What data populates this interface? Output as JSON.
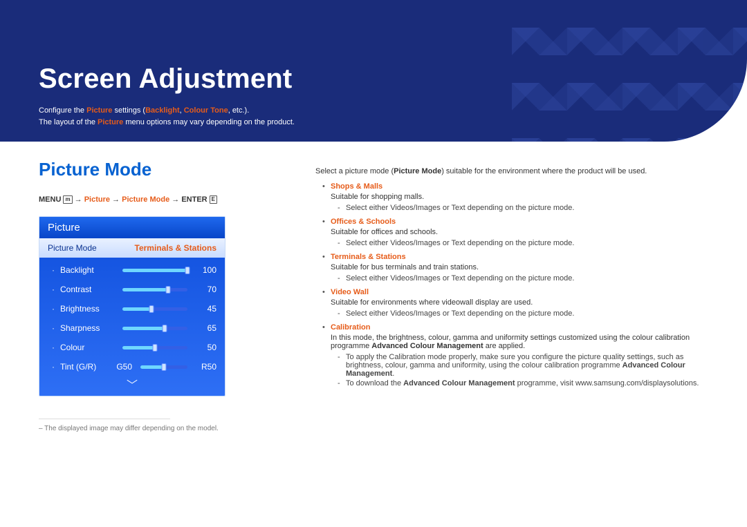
{
  "header": {
    "title": "Screen Adjustment",
    "intro_prefix": "Configure the ",
    "intro_picture": "Picture",
    "intro_mid": " settings (",
    "intro_backlight": "Backlight",
    "intro_sep": ", ",
    "intro_ctone": "Colour Tone",
    "intro_end": ", etc.).",
    "intro2_prefix": "The layout of the ",
    "intro2_picture": "Picture",
    "intro2_end": " menu options may vary depending on the product."
  },
  "section": {
    "title": "Picture Mode",
    "path_menu": "MENU",
    "path_icon": "m",
    "path_1": " → ",
    "path_picture": "Picture",
    "path_picturemode": "Picture Mode",
    "path_enter": "ENTER",
    "path_entericon": "E"
  },
  "osd": {
    "title": "Picture",
    "selector_label": "Picture Mode",
    "selector_value": "Terminals & Stations",
    "rows": [
      {
        "name": "Backlight",
        "val": "100",
        "pct": 100
      },
      {
        "name": "Contrast",
        "val": "70",
        "pct": 70
      },
      {
        "name": "Brightness",
        "val": "45",
        "pct": 45
      },
      {
        "name": "Sharpness",
        "val": "65",
        "pct": 65
      },
      {
        "name": "Colour",
        "val": "50",
        "pct": 50
      }
    ],
    "tint_name": "Tint (G/R)",
    "tint_g": "G50",
    "tint_r": "R50",
    "tint_pct": 50
  },
  "footnote": "The displayed image may differ depending on the model.",
  "right": {
    "lead_pre": "Select a picture mode (",
    "lead_bold": "Picture Mode",
    "lead_post": ") suitable for the environment where the product will be used.",
    "select_pre": "Select either ",
    "select_vi": "Videos/Images",
    "select_or": " or ",
    "select_txt": "Text",
    "select_post": " depending on the picture mode.",
    "modes": {
      "shops": {
        "name": "Shops & Malls",
        "desc": "Suitable for shopping malls."
      },
      "offices": {
        "name": "Offices & Schools",
        "desc": "Suitable for offices and schools."
      },
      "terminals": {
        "name": "Terminals & Stations",
        "desc": "Suitable for bus terminals and train stations."
      },
      "videowall": {
        "name": "Video Wall",
        "desc": "Suitable for environments where videowall display are used."
      },
      "calibration": {
        "name": "Calibration",
        "desc_pre": "In this mode, the brightness, colour, gamma and uniformity settings customized using the colour calibration programme ",
        "desc_bold": "Advanced Colour Management",
        "desc_post": " are applied.",
        "sub1_pre": "To apply the ",
        "sub1_cal": "Calibration",
        "sub1_mid": " mode properly, make sure you configure the picture quality settings, such as brightness, colour, gamma and uniformity, using the colour calibration programme ",
        "sub1_bold": "Advanced Colour Management",
        "sub1_end": ".",
        "sub2_pre": "To download the ",
        "sub2_bold": "Advanced Colour Management",
        "sub2_post": " programme, visit www.samsung.com/displaysolutions."
      }
    }
  }
}
